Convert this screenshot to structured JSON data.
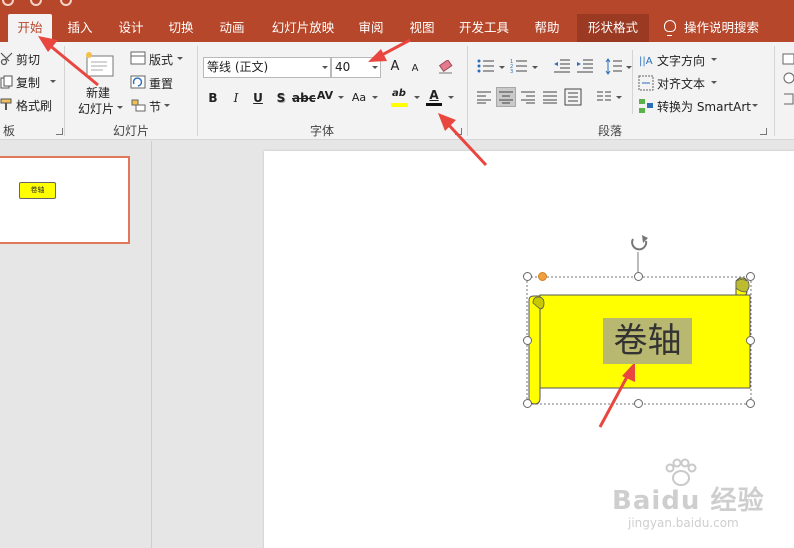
{
  "tabs": [
    {
      "id": "home",
      "label": "开始",
      "active": true
    },
    {
      "id": "insert",
      "label": "插入"
    },
    {
      "id": "design",
      "label": "设计"
    },
    {
      "id": "transitions",
      "label": "切换"
    },
    {
      "id": "animations",
      "label": "动画"
    },
    {
      "id": "slideshow",
      "label": "幻灯片放映"
    },
    {
      "id": "review",
      "label": "审阅"
    },
    {
      "id": "view",
      "label": "视图"
    },
    {
      "id": "developer",
      "label": "开发工具"
    },
    {
      "id": "help",
      "label": "帮助"
    },
    {
      "id": "shapeformat",
      "label": "形状格式"
    }
  ],
  "tellme": "操作说明搜索",
  "clipboard": {
    "cut": "剪切",
    "copy": "复制",
    "painter": "格式刷",
    "label": "板"
  },
  "slides_group": {
    "new_slide_1": "新建",
    "new_slide_2": "幻灯片",
    "layout": "版式",
    "reset": "重置",
    "section": "节",
    "label": "幻灯片"
  },
  "font_group": {
    "font_name": "等线 (正文)",
    "font_size": "40",
    "grow": "A",
    "shrink": "A",
    "bold": "B",
    "italic": "I",
    "underline": "U",
    "shadow": "S",
    "spacing": "AV",
    "case": "Aa",
    "highlight": "ab",
    "fontcolor": "A",
    "label": "字体"
  },
  "paragraph_group": {
    "text_direction": "文字方向",
    "align_text": "对齐文本",
    "smartart": "转换为 SmartArt",
    "label": "段落"
  },
  "slide_content": {
    "shape_text": "卷轴",
    "thumb_text": "卷轴"
  },
  "watermark": {
    "logo": "Baidu 经验",
    "url": "jingyan.baidu.com"
  },
  "colors": {
    "accent": "#b7472a",
    "shape_fill": "#ffff00",
    "highlight_fill": "#b8b870",
    "annotation_arrow": "#e8463f"
  }
}
